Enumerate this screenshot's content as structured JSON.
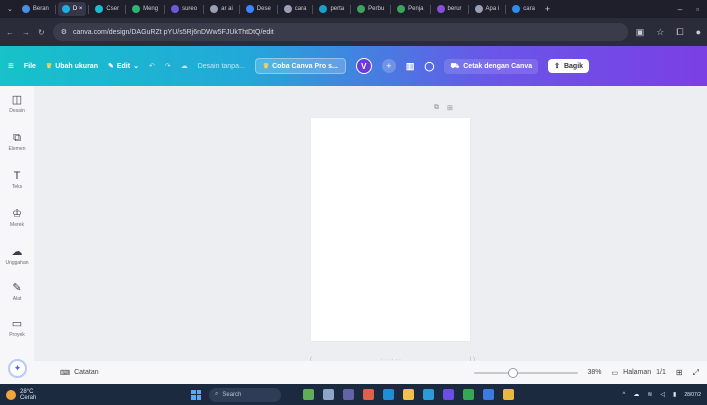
{
  "browser": {
    "tabs": [
      {
        "label": "Beran",
        "color": "#4a90e2",
        "active": false
      },
      {
        "label": "D ×",
        "color": "#1ab0e0",
        "active": true
      },
      {
        "label": "Cser",
        "color": "#1abcd0",
        "active": false
      },
      {
        "label": "Meng",
        "color": "#2bb673",
        "active": false
      },
      {
        "label": "sureo",
        "color": "#6a5ae0",
        "active": false
      },
      {
        "label": "ar ai",
        "color": "#9aa0b4",
        "active": false
      },
      {
        "label": "Dese",
        "color": "#3a86ff",
        "active": false
      },
      {
        "label": "cara",
        "color": "#9aa0b4",
        "active": false
      },
      {
        "label": "perta",
        "color": "#18a0c8",
        "active": false
      },
      {
        "label": "Perbu",
        "color": "#3aa55d",
        "active": false
      },
      {
        "label": "Penja",
        "color": "#3aa55d",
        "active": false
      },
      {
        "label": "berur",
        "color": "#8a4fd6",
        "active": false
      },
      {
        "label": "Apa i",
        "color": "#9aa0b4",
        "active": false
      },
      {
        "label": "cara",
        "color": "#2d8cf0",
        "active": false
      }
    ],
    "url": "canva.com/design/DAGuRZt pYU/s5Rj6nDWw5FJUkThtDtQ/edit"
  },
  "header": {
    "file": "File",
    "resize": "Ubah ukuran",
    "edit": "Edit",
    "title": "Desain tanpa...",
    "pro": "Coba Canva Pro s...",
    "avatar": "V",
    "print": "Cetak dengan Canva",
    "share": "Bagik"
  },
  "sidebar": {
    "items": [
      {
        "label": "Desain",
        "icon": "◫"
      },
      {
        "label": "Elemen",
        "icon": "⧉"
      },
      {
        "label": "Teks",
        "icon": "T"
      },
      {
        "label": "Merek",
        "icon": "♔"
      },
      {
        "label": "Unggahan",
        "icon": "☁"
      },
      {
        "label": "Alat",
        "icon": "✎"
      },
      {
        "label": "Proyek",
        "icon": "▭"
      }
    ]
  },
  "canvas": {
    "page_strip_left": "(",
    "page_strip_dots": "· · · · · ·",
    "page_strip_right": "| )"
  },
  "bottom": {
    "notes": "Catatan",
    "zoom": "38%",
    "zoom_level": 0.38,
    "pages_label": "Halaman",
    "pages_value": "1/1"
  },
  "taskbar": {
    "temp": "28°C",
    "weather": "Cerah",
    "search": "Search",
    "date": "28/07/2"
  },
  "colors": {
    "accent": "#7b3fe4",
    "teal": "#17c2c9"
  }
}
